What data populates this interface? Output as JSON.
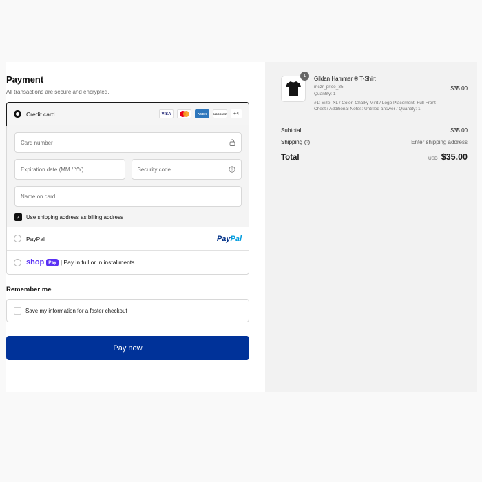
{
  "payment": {
    "title": "Payment",
    "subtitle": "All transactions are secure and encrypted.",
    "credit_card": {
      "label": "Credit card",
      "card_brands": [
        "VISA",
        "mastercard",
        "AMEX",
        "DISCOVER"
      ],
      "more_label": "+4",
      "card_number_placeholder": "Card number",
      "expiration_placeholder": "Expiration date (MM / YY)",
      "security_code_placeholder": "Security code",
      "name_placeholder": "Name on card",
      "billing_checkbox_label": "Use shipping address as billing address",
      "billing_checked": true
    },
    "paypal": {
      "label": "PayPal",
      "logo_text": "PayPal"
    },
    "shop_pay": {
      "logo_word": "shop",
      "logo_badge": "Pay",
      "label": "| Pay in full or in installments"
    }
  },
  "remember": {
    "title": "Remember me",
    "checkbox_label": "Save my information for a faster checkout",
    "checked": false
  },
  "pay_button": {
    "label": "Pay now",
    "color": "#003299"
  },
  "order": {
    "item": {
      "quantity_badge": "1",
      "name": "Gildan Hammer ® T-Shirt",
      "sku": "mczr_price_35",
      "quantity_line": "Quantity: 1",
      "details": "#1: Size: XL / Color: Chalky Mint / Logo Placement: Full Front Chest / Additional Notes: Untitled answer / Quantity: 1",
      "price": "$35.00",
      "icon": "tshirt-icon"
    },
    "subtotal_label": "Subtotal",
    "subtotal_value": "$35.00",
    "shipping_label": "Shipping",
    "shipping_value": "Enter shipping address",
    "total_label": "Total",
    "currency": "USD",
    "total_value": "$35.00"
  }
}
